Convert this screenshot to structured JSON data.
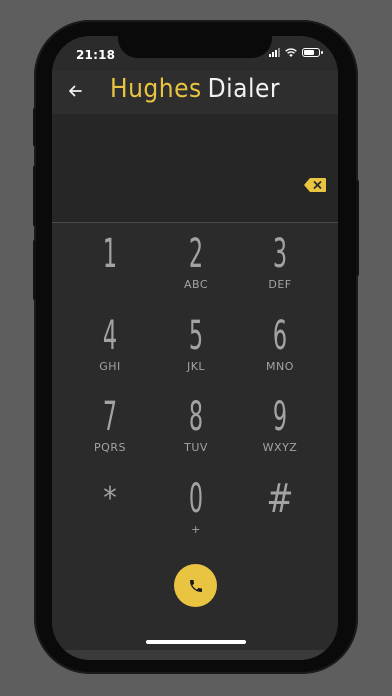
{
  "theme": {
    "accent": "#e8c441",
    "page_bg": "#5e5e5e",
    "screen_bg": "#2b2b2b",
    "key_color": "#a3a3a3"
  },
  "status_bar": {
    "time": "21:18",
    "icons": [
      "signal-icon",
      "wifi-icon",
      "battery-icon"
    ]
  },
  "header": {
    "back_icon": "arrow-left-icon",
    "title_part1": "Hughes",
    "title_part2": "Dialer"
  },
  "display": {
    "number": "",
    "backspace_icon": "backspace-icon"
  },
  "keypad": {
    "keys": [
      {
        "digit": "1",
        "letters": ""
      },
      {
        "digit": "2",
        "letters": "ABC"
      },
      {
        "digit": "3",
        "letters": "DEF"
      },
      {
        "digit": "4",
        "letters": "GHI"
      },
      {
        "digit": "5",
        "letters": "JKL"
      },
      {
        "digit": "6",
        "letters": "MNO"
      },
      {
        "digit": "7",
        "letters": "PQRS"
      },
      {
        "digit": "8",
        "letters": "TUV"
      },
      {
        "digit": "9",
        "letters": "WXYZ"
      },
      {
        "digit": "*",
        "letters": ""
      },
      {
        "digit": "0",
        "letters": "+"
      },
      {
        "digit": "#",
        "letters": ""
      }
    ]
  },
  "call_button": {
    "icon": "phone-icon"
  }
}
